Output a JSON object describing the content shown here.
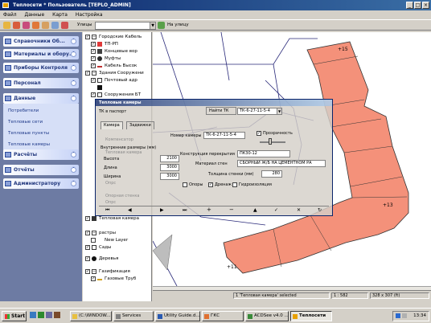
{
  "window": {
    "title": "Теплосети * Пользователь [TEPLO_ADMIN]"
  },
  "menu": [
    "Файл",
    "Данные",
    "Карта",
    "Настройка"
  ],
  "toolbar": {
    "street_label": "Улицы",
    "goto_street_label": "На улицу"
  },
  "sidebar": {
    "sections": [
      "Справочники Об...",
      "Материалы и обору...",
      "Приборы Контроля",
      "Персонал",
      "Данные",
      "Расчёты",
      "Отчёты",
      "Администратору"
    ],
    "data_links": [
      "Потребители",
      "Тепловые сети",
      "Тепловые пункты",
      "Тепловые камеры"
    ]
  },
  "tree": {
    "items": [
      "Городские Кабель",
      "ТП-РП",
      "Концевые вор",
      "Муфты",
      "Кабель Высок",
      "Здания Сооружени",
      "Почтовый адр",
      "",
      "Сооружения БТ",
      "Тепловая камера",
      "растры",
      "New Layer",
      "Сады",
      "Деревья",
      "Газификация",
      "Газовые Труб"
    ]
  },
  "map": {
    "labels": [
      "+15",
      "+13",
      "+11"
    ],
    "building_color": "#f4917a",
    "line_color": "#2a2a7a"
  },
  "map_status": {
    "selection": "1 'Тепловая камера' selected",
    "scale": "1 : 582",
    "coords": "328 x 307 (ft)"
  },
  "dialog": {
    "title": "Тепловые камеры",
    "search_button": "Найти ТК",
    "search_value": "ТК-6-27-11-5-4",
    "passport_label": "ТК в паспорт",
    "tabs": [
      "Камера",
      "Задвижки"
    ],
    "fields": {
      "camera_number_label": "Номер камеры",
      "camera_number": "ТК-6-27-11-5-4",
      "transparent_label": "Прозрачность",
      "inner_dims_label": "Внутренние размеры (мм)",
      "height_label": "Высота",
      "height": "2100",
      "length_label": "Длина",
      "length": "3000",
      "width_label": "Ширина",
      "width": "3000",
      "overlap_label": "Конструкция перекрытия",
      "overlap": "ПК30-12",
      "wall_material_label": "Материал стен",
      "wall_material": "СБОРНЫЙ Ж/Б НА ЦЕМЕНТНОМ РА",
      "wall_thickness_label": "Толщина стенки (мм)",
      "wall_thickness": "280",
      "supports_label": "Опоры",
      "drainage_label": "Дренаж",
      "waterproof_label": "Гидроизоляция"
    },
    "ghost_texts": [
      "Компенсатор",
      "Тепловая камера",
      "Опрс",
      "Опорная стенка",
      "Опрс"
    ]
  },
  "taskbar": {
    "start": "Start",
    "buttons": [
      "(C:\\WINDOW...",
      "Services",
      "Utility Guide.d...",
      "ГКС",
      "ACDSee v4.0 ...",
      "Теплосети"
    ],
    "clock": "13:34"
  }
}
